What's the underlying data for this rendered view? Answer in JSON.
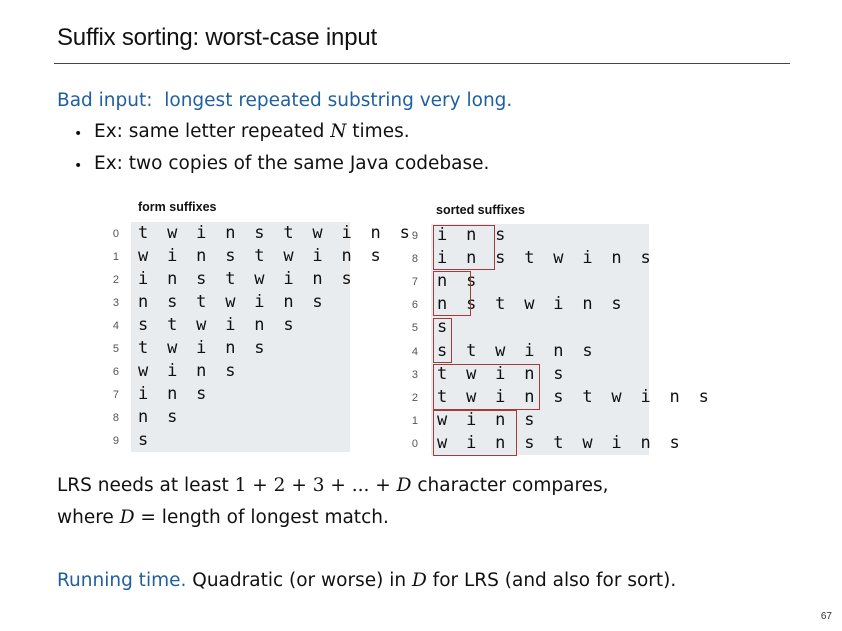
{
  "title": "Suffix sorting:  worst-case input",
  "bad_input": {
    "label": "Bad input:",
    "text": "longest repeated substring very long."
  },
  "bullets": [
    {
      "prefix": "Ex:  same letter repeated ",
      "var": "N",
      "suffix": " times."
    },
    {
      "prefix": "Ex:  two copies of the same Java codebase.",
      "var": "",
      "suffix": ""
    }
  ],
  "form_caption": "form suffixes",
  "sorted_caption": "sorted suffixes",
  "form_rows": [
    {
      "index": "0",
      "text": "t w i n s t w i n s"
    },
    {
      "index": "1",
      "text": "w i n s t w i n s"
    },
    {
      "index": "2",
      "text": "i n s t w i n s"
    },
    {
      "index": "3",
      "text": "n s t w i n s"
    },
    {
      "index": "4",
      "text": "s t w i n s"
    },
    {
      "index": "5",
      "text": "t w i n s"
    },
    {
      "index": "6",
      "text": "w i n s"
    },
    {
      "index": "7",
      "text": "i n s"
    },
    {
      "index": "8",
      "text": "n s"
    },
    {
      "index": "9",
      "text": "s"
    }
  ],
  "sorted_rows": [
    {
      "index": "9",
      "text": "i n s"
    },
    {
      "index": "8",
      "text": "i n s t w i n s"
    },
    {
      "index": "7",
      "text": "n s"
    },
    {
      "index": "6",
      "text": "n s t w i n s"
    },
    {
      "index": "5",
      "text": "s"
    },
    {
      "index": "4",
      "text": "s t w i n s"
    },
    {
      "index": "3",
      "text": "t w i n s"
    },
    {
      "index": "2",
      "text": "t w i n s t w i n s"
    },
    {
      "index": "1",
      "text": "w i n s"
    },
    {
      "index": "0",
      "text": "w i n s t w i n s"
    }
  ],
  "lrs": {
    "line1_prefix": "LRS needs at least ",
    "formula_a": "1 + 2 + 3 + ... + ",
    "formula_var": "D",
    "line1_suffix": " character compares,",
    "line2_prefix": "where ",
    "line2_var": "D",
    "line2_suffix": " = length of longest match."
  },
  "running_time": {
    "label": "Running time.",
    "prefix": "  Quadratic (or worse) in ",
    "var": "D",
    "suffix": " for LRS (and also for sort)."
  },
  "page_number": "67",
  "colors": {
    "accent": "#1f5f9e",
    "box": "#a33b3b",
    "panel": "#e8ecee"
  }
}
